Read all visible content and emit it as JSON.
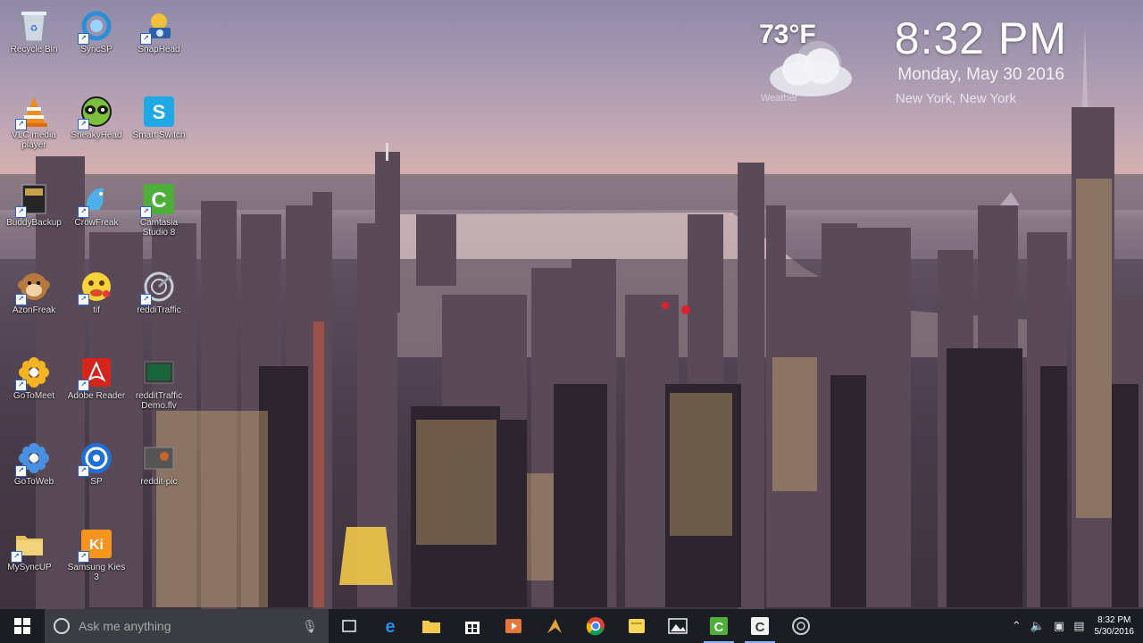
{
  "weather": {
    "temperature": "73°F",
    "icon": "cloud-icon",
    "caption": "Weather"
  },
  "clock": {
    "time": "8:32 PM",
    "date": "Monday, May 30 2016",
    "location": "New York, New York"
  },
  "desktop_icons": [
    {
      "label": "Recycle Bin",
      "icon": "recycle-bin-icon"
    },
    {
      "label": "SyncSP",
      "icon": "syncsp-icon"
    },
    {
      "label": "SnapHead",
      "icon": "snaphead-icon"
    },
    {
      "label": "VLC media player",
      "icon": "vlc-icon"
    },
    {
      "label": "SneakyHead",
      "icon": "sneakyhead-icon"
    },
    {
      "label": "Smart Switch",
      "icon": "smart-switch-icon"
    },
    {
      "label": "BuddyBackup",
      "icon": "buddy-backup-icon"
    },
    {
      "label": "CrowFreak",
      "icon": "crowfreak-icon"
    },
    {
      "label": "Camtasia Studio 8",
      "icon": "camtasia-icon"
    },
    {
      "label": "AzonFreak",
      "icon": "azonfreak-icon"
    },
    {
      "label": "tif",
      "icon": "emoji-icon"
    },
    {
      "label": "reddiTraffic",
      "icon": "redditraffic-icon"
    },
    {
      "label": "GoToMeet",
      "icon": "gotomeeting-icon"
    },
    {
      "label": "Adobe Reader",
      "icon": "adobe-reader-icon"
    },
    {
      "label": "redditTraffic Demo.flv",
      "icon": "video-file-icon"
    },
    {
      "label": "GoToWeb",
      "icon": "gotowebinar-icon"
    },
    {
      "label": "SP",
      "icon": "sp-icon"
    },
    {
      "label": "reddit-pic",
      "icon": "image-file-icon"
    },
    {
      "label": "MySyncUP",
      "icon": "folder-icon"
    },
    {
      "label": "Samsung Kies 3",
      "icon": "kies-icon"
    }
  ],
  "taskbar": {
    "search_placeholder": "Ask me anything",
    "apps": [
      {
        "name": "task-view",
        "icon": "task-view-icon"
      },
      {
        "name": "edge",
        "icon": "edge-icon"
      },
      {
        "name": "file-explorer",
        "icon": "folder-icon"
      },
      {
        "name": "store",
        "icon": "store-icon"
      },
      {
        "name": "media-player",
        "icon": "media-icon"
      },
      {
        "name": "winamp",
        "icon": "winamp-icon"
      },
      {
        "name": "chrome",
        "icon": "chrome-icon"
      },
      {
        "name": "sticky-notes",
        "icon": "notes-icon"
      },
      {
        "name": "photos",
        "icon": "photos-icon"
      },
      {
        "name": "camtasia-studio",
        "icon": "camtasia-icon"
      },
      {
        "name": "camtasia-recorder",
        "icon": "camtasia-recorder-icon"
      },
      {
        "name": "redditraffic",
        "icon": "redditraffic-icon"
      }
    ],
    "tray_time": "8:32 PM",
    "tray_date": "5/30/2016"
  }
}
